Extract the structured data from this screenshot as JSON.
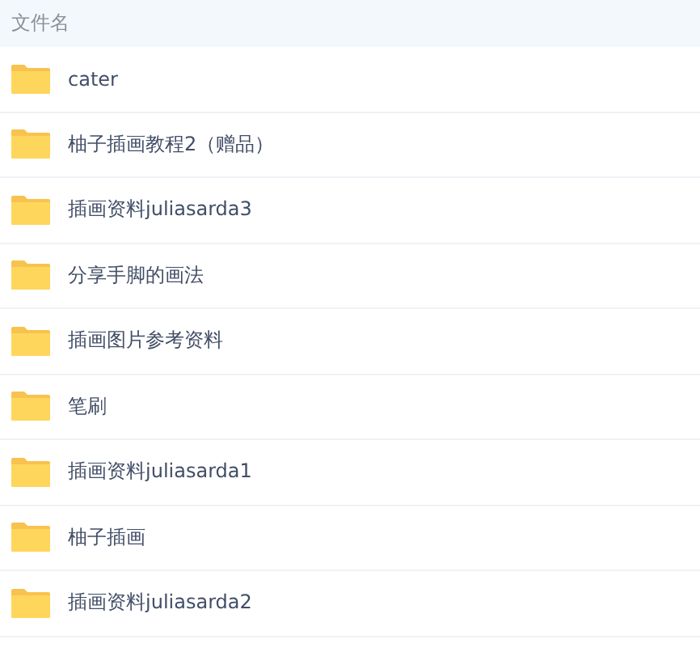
{
  "table": {
    "columns": [
      "文件名"
    ],
    "rows": [
      {
        "name": "cater"
      },
      {
        "name": "柚子插画教程2（赠品）"
      },
      {
        "name": "插画资料juliasarda3"
      },
      {
        "name": "分享手脚的画法"
      },
      {
        "name": "插画图片参考资料"
      },
      {
        "name": "笔刷"
      },
      {
        "name": "插画资料juliasarda1"
      },
      {
        "name": "柚子插画"
      },
      {
        "name": "插画资料juliasarda2"
      }
    ]
  }
}
